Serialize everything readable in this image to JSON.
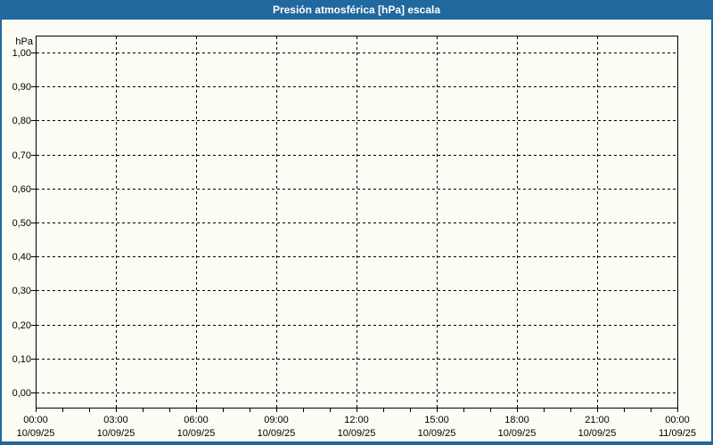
{
  "window": {
    "title": "Presión atmosférica [hPa] escala",
    "titlebar_bg": "#20689E",
    "border_color": "#20689E",
    "page_bg": "#FCFCF4"
  },
  "chart_data": {
    "type": "line",
    "title": "Presión atmosférica [hPa] escala",
    "xlabel": "",
    "ylabel": "hPa",
    "ylim": [
      0.0,
      1.0
    ],
    "y_tick_step": 0.1,
    "y_ticks": [
      {
        "value": 1.0,
        "label": "1,00"
      },
      {
        "value": 0.9,
        "label": "0,90"
      },
      {
        "value": 0.8,
        "label": "0,80"
      },
      {
        "value": 0.7,
        "label": "0,70"
      },
      {
        "value": 0.6,
        "label": "0,60"
      },
      {
        "value": 0.5,
        "label": "0,50"
      },
      {
        "value": 0.4,
        "label": "0,40"
      },
      {
        "value": 0.3,
        "label": "0,30"
      },
      {
        "value": 0.2,
        "label": "0,20"
      },
      {
        "value": 0.1,
        "label": "0,10"
      },
      {
        "value": 0.0,
        "label": "0,00"
      }
    ],
    "x_axis": {
      "range_hours": [
        0,
        24
      ],
      "minor_tick_interval_hours": 1,
      "major_ticks": [
        {
          "hour": 0,
          "time": "00:00",
          "date": "10/09/25"
        },
        {
          "hour": 3,
          "time": "03:00",
          "date": "10/09/25"
        },
        {
          "hour": 6,
          "time": "06:00",
          "date": "10/09/25"
        },
        {
          "hour": 9,
          "time": "09:00",
          "date": "10/09/25"
        },
        {
          "hour": 12,
          "time": "12:00",
          "date": "10/09/25"
        },
        {
          "hour": 15,
          "time": "15:00",
          "date": "10/09/25"
        },
        {
          "hour": 18,
          "time": "18:00",
          "date": "10/09/25"
        },
        {
          "hour": 21,
          "time": "21:00",
          "date": "10/09/25"
        },
        {
          "hour": 24,
          "time": "00:00",
          "date": "11/09/25"
        }
      ]
    },
    "grid": {
      "style": "dashed",
      "color": "#000000",
      "on": true
    },
    "legend": "none",
    "series": []
  }
}
